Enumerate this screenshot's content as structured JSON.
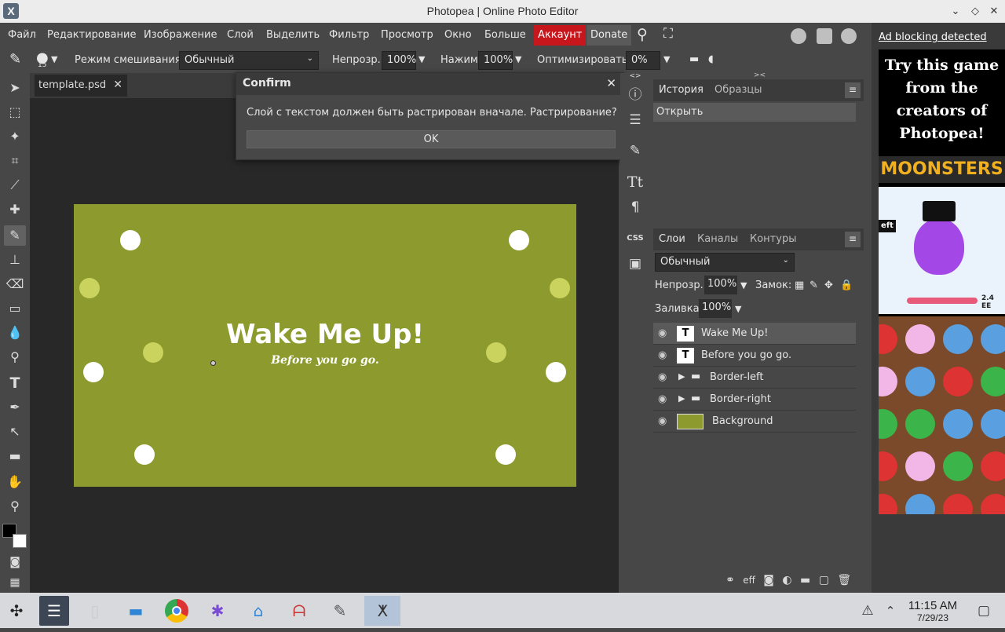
{
  "window": {
    "title": "Photopea | Online Photo Editor",
    "app_icon": "X"
  },
  "menu": {
    "items": [
      "Файл",
      "Редактирование",
      "Изображение",
      "Слой",
      "Выделить",
      "Фильтр",
      "Просмотр",
      "Окно",
      "Больше"
    ],
    "account": "Аккаунт",
    "donate": "Donate"
  },
  "options": {
    "brush_size": "15",
    "blend_label": "Режим смешивания:",
    "blend_value": "Обычный",
    "opacity_label": "Непрозр.:",
    "opacity_value": "100%",
    "pressure_label": "Нажим:",
    "pressure_value": "100%",
    "optimize_label": "Оптимизировать:",
    "optimize_value": "0%"
  },
  "document": {
    "tab_name": "template.psd",
    "headline": "Wake Me Up!",
    "subline": "Before you go go."
  },
  "dialog": {
    "title": "Confirm",
    "message": "Слой с текстом должен быть растрирован вначале. Растрирование?",
    "ok": "OK"
  },
  "sidestrip": {
    "css_label": "CSS"
  },
  "history_panel": {
    "tabs": [
      "История",
      "Образцы"
    ],
    "items": [
      "Открыть"
    ]
  },
  "layers_panel": {
    "tabs": [
      "Слои",
      "Каналы",
      "Контуры"
    ],
    "blend_value": "Обычный",
    "opacity_label": "Непрозр.:",
    "opacity_value": "100%",
    "lock_label": "Замок:",
    "fill_label": "Заливка:",
    "fill_value": "100%",
    "layers": [
      {
        "name": "Wake Me Up!",
        "kind": "text",
        "selected": true
      },
      {
        "name": "Before you go go.",
        "kind": "text",
        "selected": false
      },
      {
        "name": "Border-left",
        "kind": "folder",
        "selected": false
      },
      {
        "name": "Border-right",
        "kind": "folder",
        "selected": false
      },
      {
        "name": "Background",
        "kind": "image",
        "selected": false
      }
    ],
    "footer_fx": "eff"
  },
  "ad": {
    "notice": "Ad blocking detected",
    "text": "Try this game from the creators of Photopea!",
    "game_title": "MOONSTERS",
    "badge": "eft",
    "score": "2.4 EE"
  },
  "taskbar": {
    "time": "11:15 AM",
    "date": "7/29/23"
  },
  "colors": {
    "accent_account": "#c8161d",
    "canvas_bg": "#8c9a2e",
    "dot_white": "#ffffff",
    "dot_light": "#c9d35e"
  }
}
